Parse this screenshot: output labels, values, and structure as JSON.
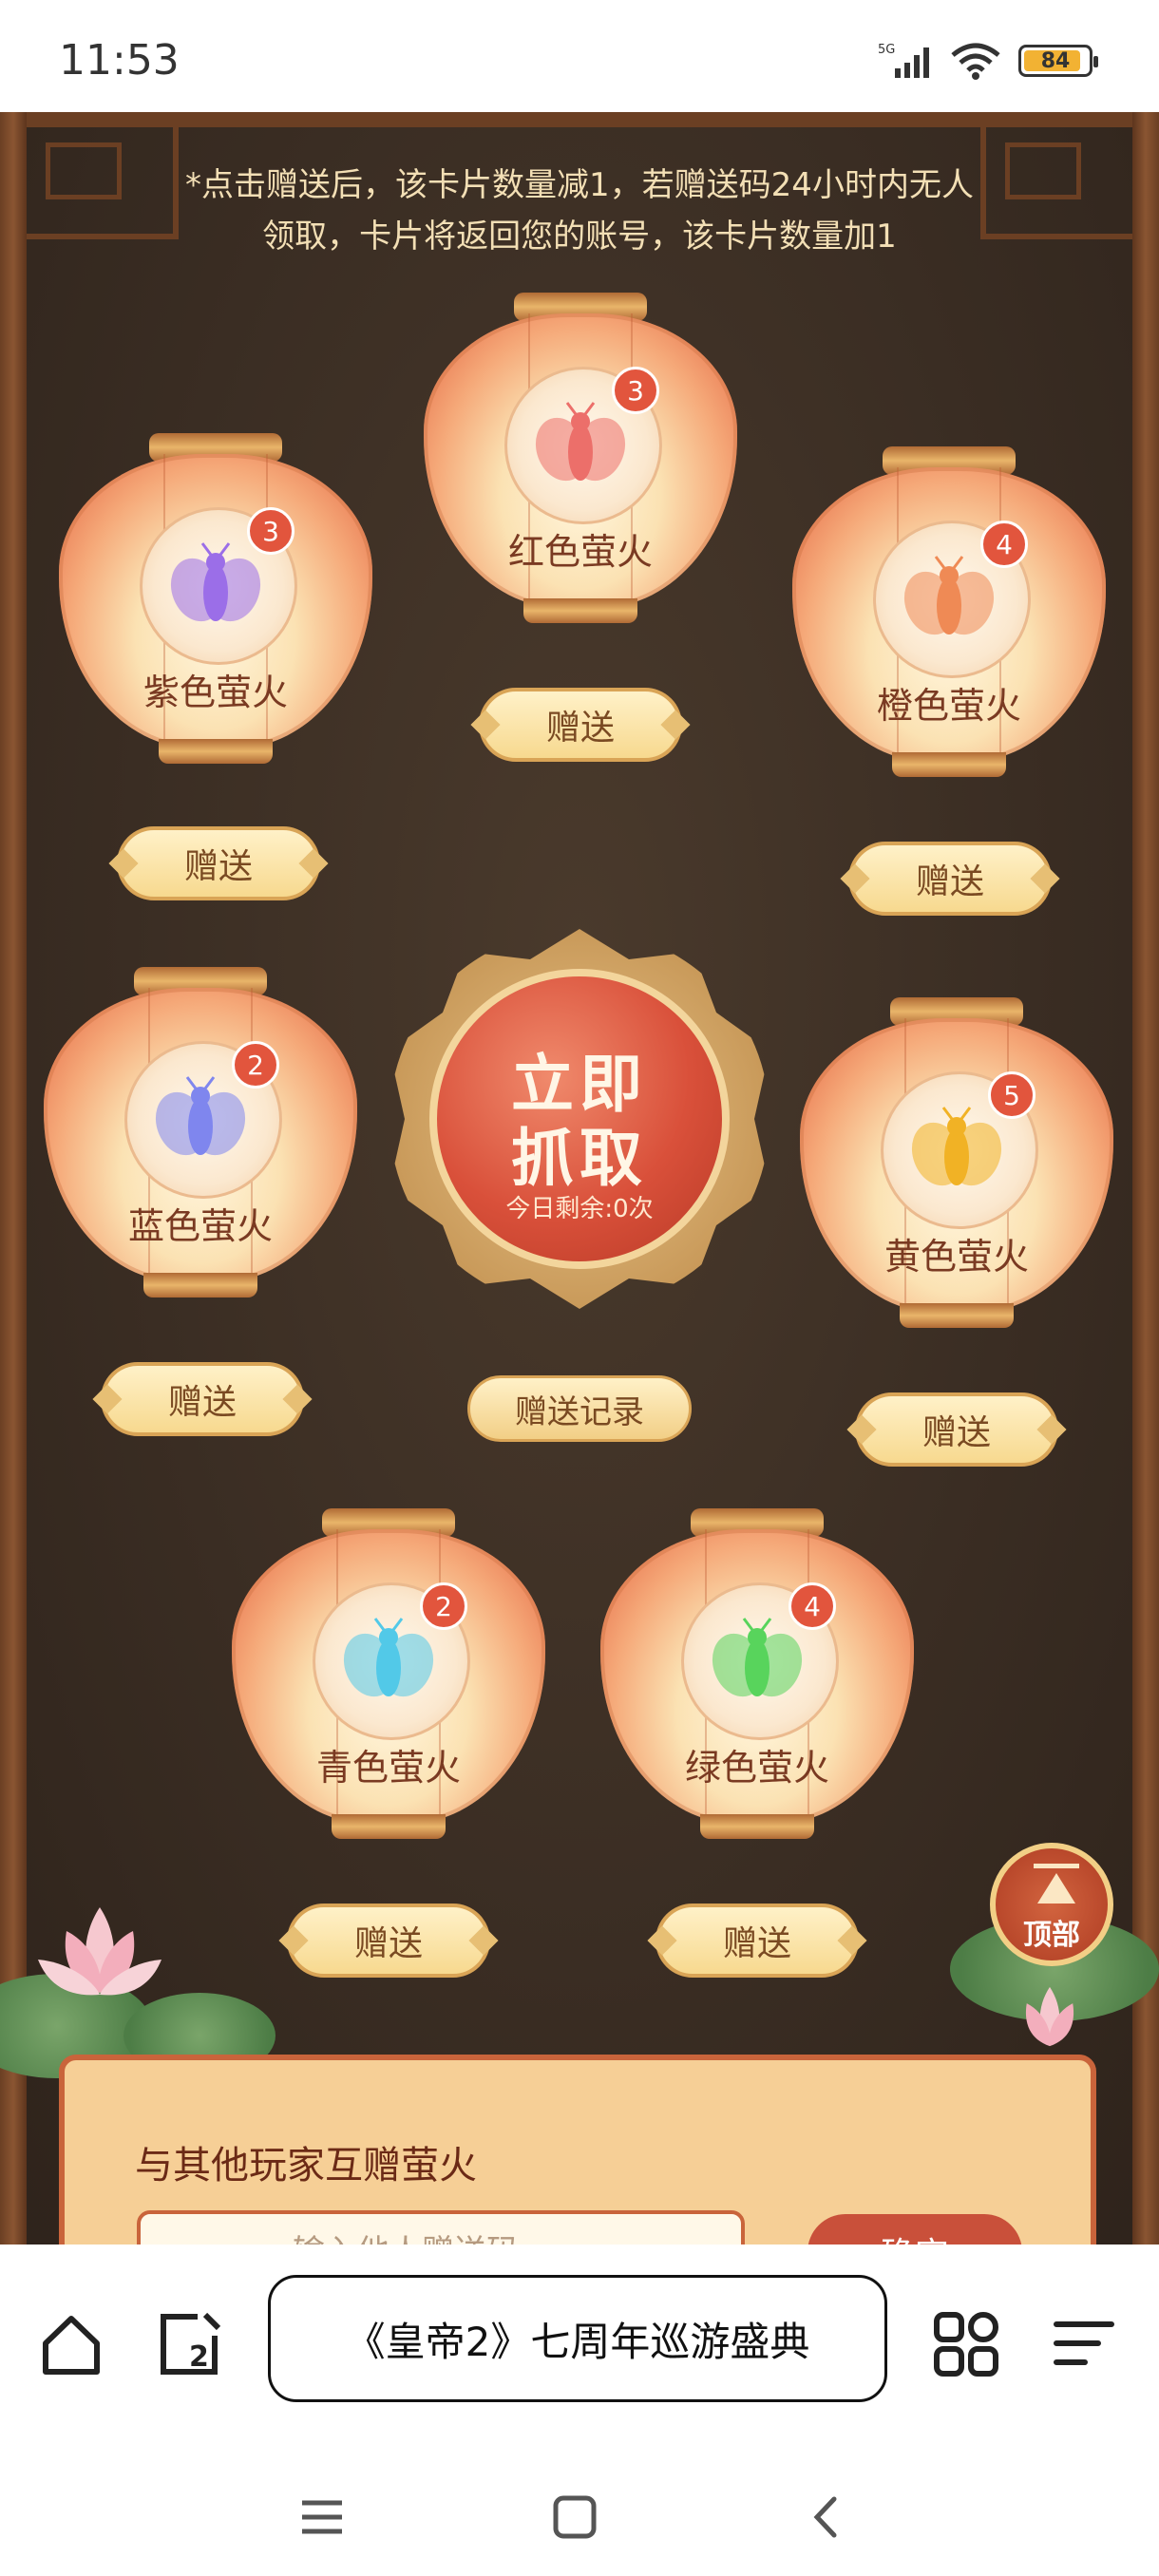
{
  "status_bar": {
    "time": "11:53",
    "network": "5G",
    "battery": "84"
  },
  "notice": {
    "line1": "*点击赠送后，该卡片数量减1，若赠送码24小时内无人",
    "line2": "领取，卡片将返回您的账号，该卡片数量加1"
  },
  "lanterns": [
    {
      "name": "紫色萤火",
      "count": "3",
      "color": "#9b6ee8"
    },
    {
      "name": "红色萤火",
      "count": "3",
      "color": "#ec6f6a"
    },
    {
      "name": "橙色萤火",
      "count": "4",
      "color": "#ef8a55"
    },
    {
      "name": "蓝色萤火",
      "count": "2",
      "color": "#7f86ee"
    },
    {
      "name": "黄色萤火",
      "count": "5",
      "color": "#f1b225"
    },
    {
      "name": "青色萤火",
      "count": "2",
      "color": "#52c9e8"
    },
    {
      "name": "绿色萤火",
      "count": "4",
      "color": "#58d45c"
    }
  ],
  "gift_label": "赠送",
  "grab": {
    "line1": "立即",
    "line2": "抓取",
    "remaining": "今日剩余:0次"
  },
  "record_label": "赠送记录",
  "top_button": "顶部",
  "exchange": {
    "title": "与其他玩家互赠萤火",
    "placeholder": "输入他人赠送码",
    "confirm": "确定"
  },
  "browser": {
    "page_title": "《皇帝2》七周年巡游盛典",
    "tab_count": "2"
  }
}
